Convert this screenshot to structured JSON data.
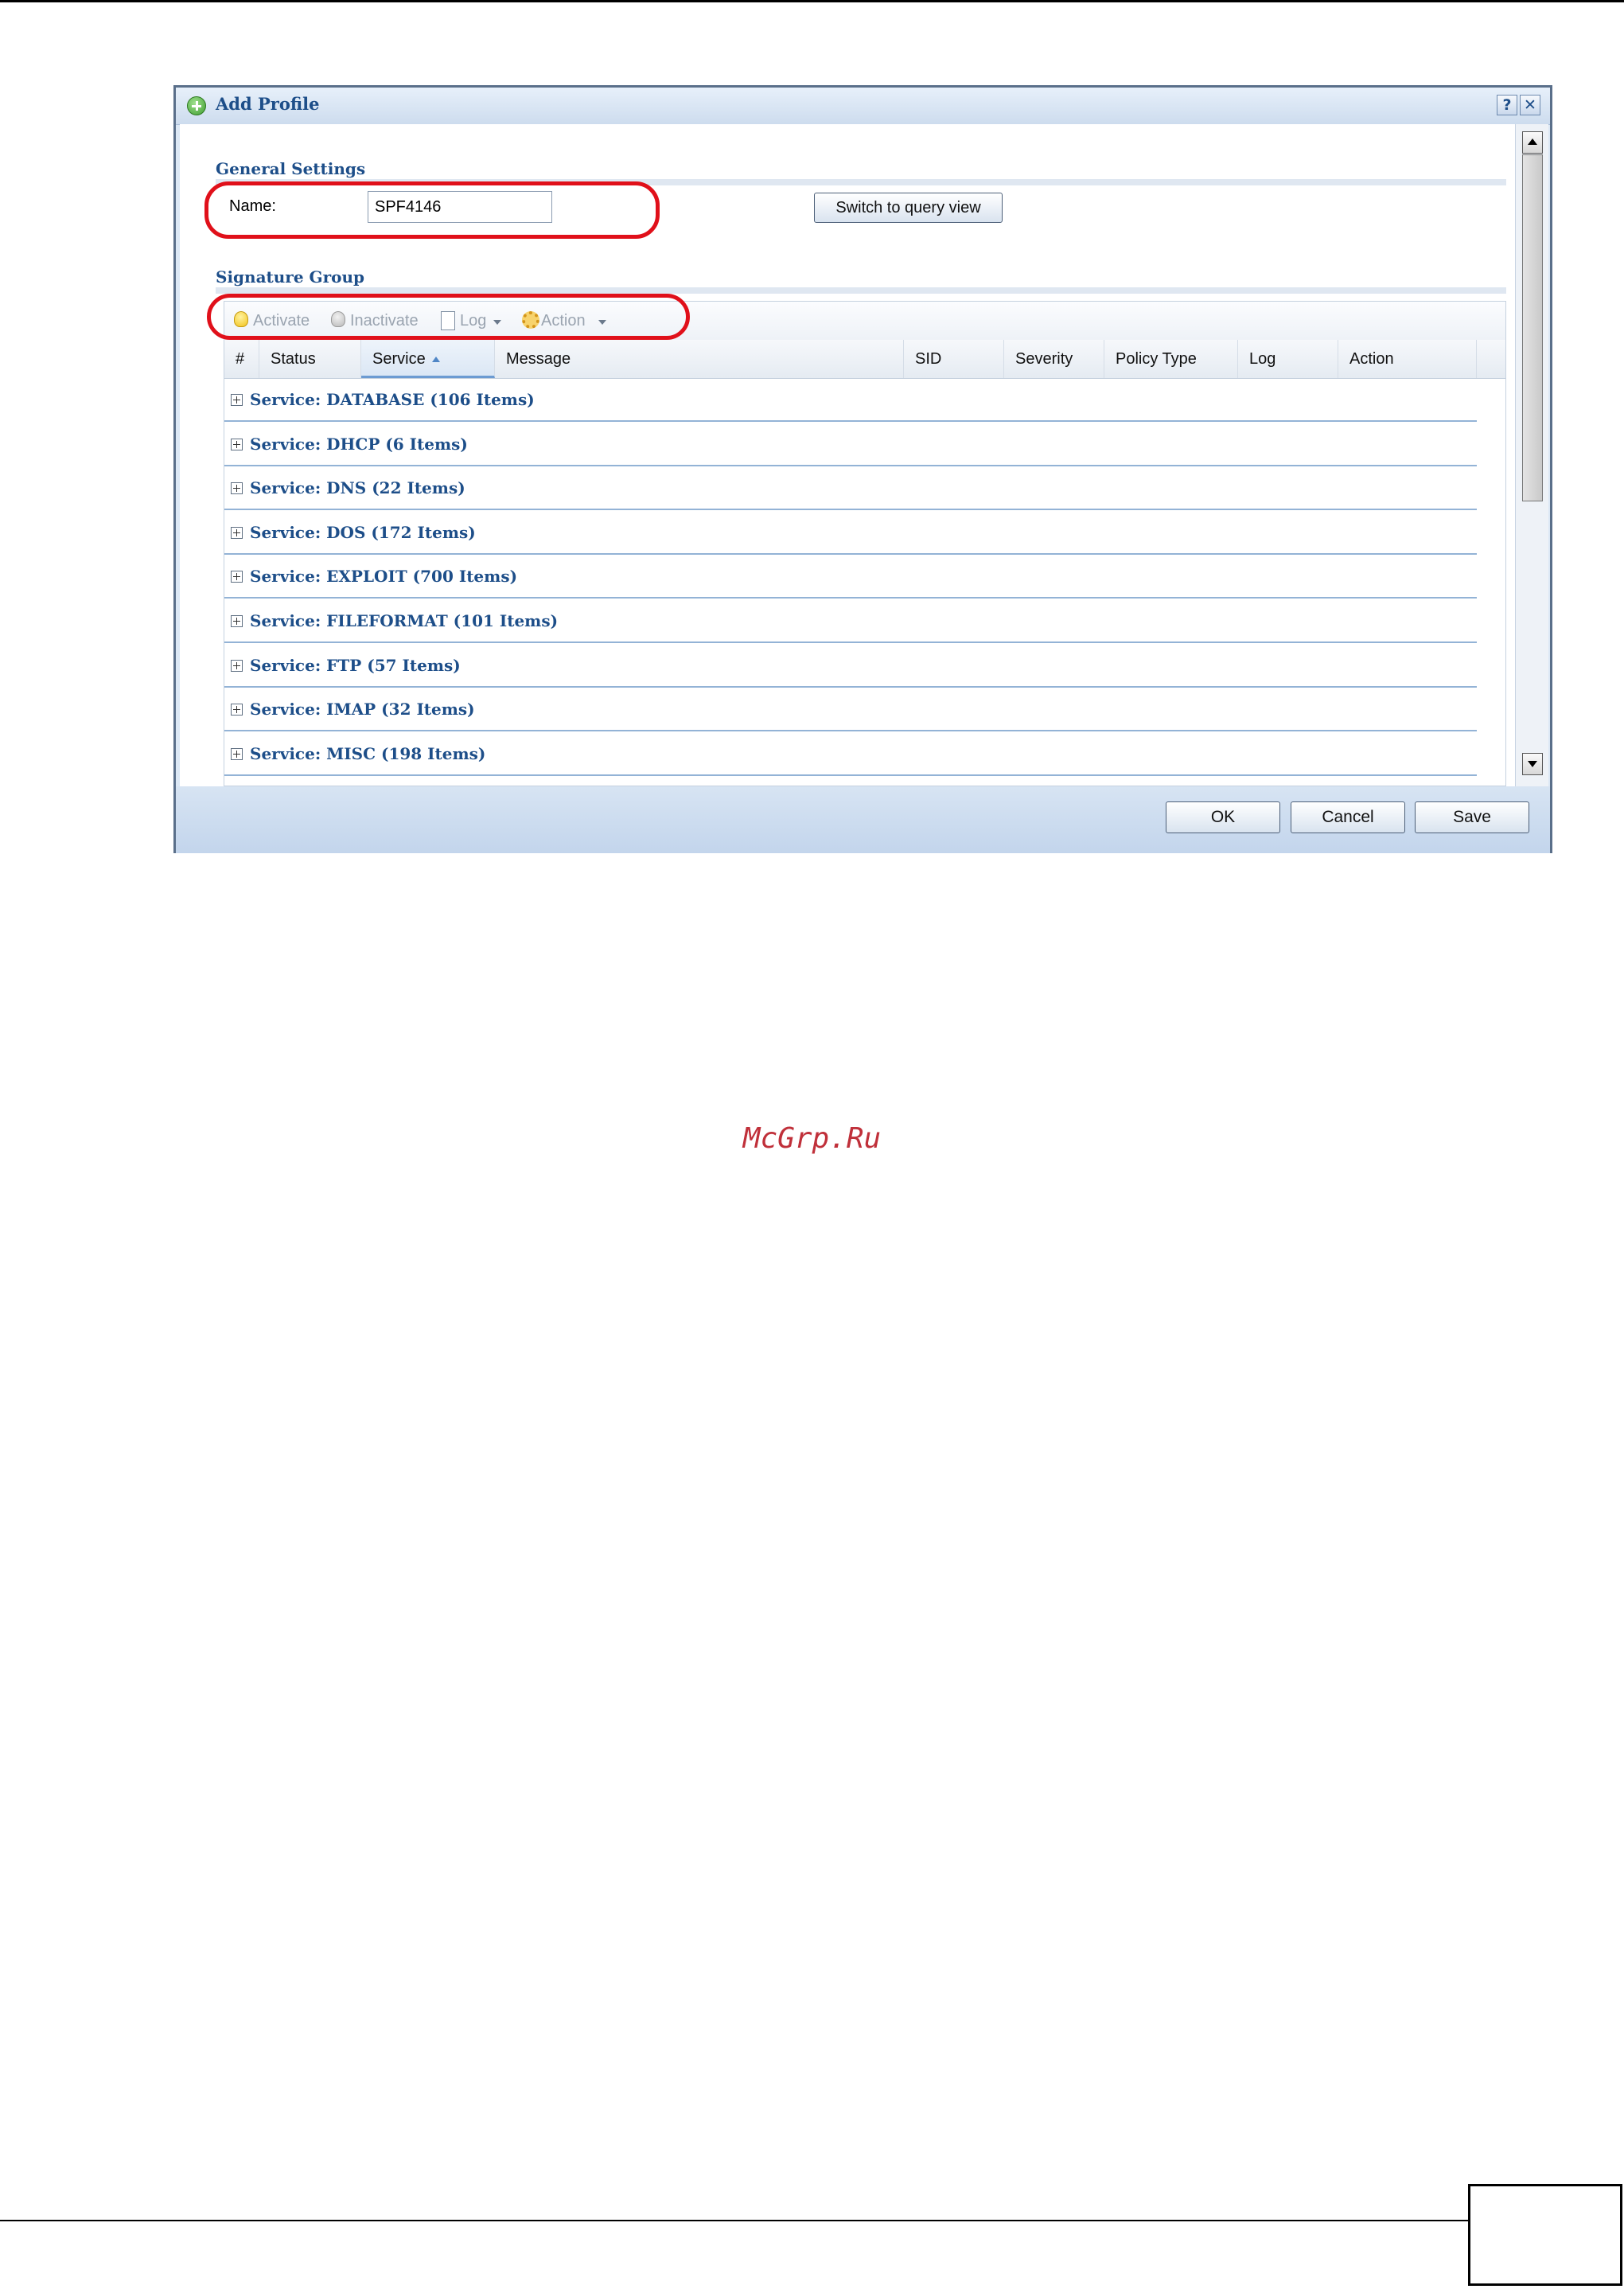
{
  "dialog": {
    "title": "Add Profile",
    "help_label": "?",
    "close_label": "✕"
  },
  "general": {
    "section_title": "General Settings",
    "name_label": "Name:",
    "name_value": "SPF4146",
    "switch_button": "Switch to query view"
  },
  "signature": {
    "section_title": "Signature Group",
    "toolbar": {
      "activate": "Activate",
      "inactivate": "Inactivate",
      "log": "Log",
      "action": "Action"
    },
    "columns": [
      "#",
      "Status",
      "Service",
      "Message",
      "SID",
      "Severity",
      "Policy Type",
      "Log",
      "Action"
    ],
    "groups": [
      "Service: DATABASE (106 Items)",
      "Service: DHCP (6 Items)",
      "Service: DNS (22 Items)",
      "Service: DOS (172 Items)",
      "Service: EXPLOIT (700 Items)",
      "Service: FILEFORMAT (101 Items)",
      "Service: FTP (57 Items)",
      "Service: IMAP (32 Items)",
      "Service: MISC (198 Items)"
    ]
  },
  "footer": {
    "ok": "OK",
    "cancel": "Cancel",
    "save": "Save"
  },
  "watermark": "McGrp.Ru",
  "colors": {
    "accent": "#1d4e89",
    "highlight_ring": "#e0101a",
    "watermark": "#c0303a"
  }
}
